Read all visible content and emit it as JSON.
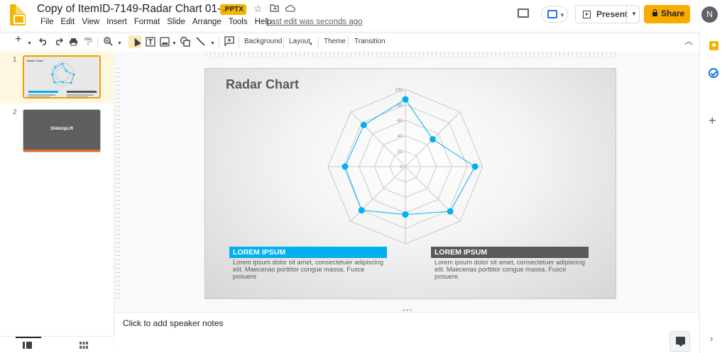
{
  "app": {
    "doc_title": "Copy of ItemID-7149-Radar Chart 01-16x9",
    "file_badge": ".PPTX",
    "last_edit": "Last edit was seconds ago",
    "avatar_initial": "N"
  },
  "menu": [
    "File",
    "Edit",
    "View",
    "Insert",
    "Format",
    "Slide",
    "Arrange",
    "Tools",
    "Help"
  ],
  "header_buttons": {
    "present": "Present",
    "share": "Share"
  },
  "toolbar": {
    "background": "Background",
    "layout": "Layout",
    "theme": "Theme",
    "transition": "Transition"
  },
  "filmstrip": {
    "slides": [
      {
        "number": "1",
        "thumb_title": "Radar Chart"
      },
      {
        "number": "2",
        "thumb_title": "SlideUpLift"
      }
    ]
  },
  "slide": {
    "title": "Radar Chart",
    "box_left": {
      "title": "LOREM IPSUM",
      "text": "Lorem ipsum dolor sit amet, consectetuer adipiscing elit. Maecenas porttitor congue massa. Fusce posuere",
      "color": "#00b0f0"
    },
    "box_right": {
      "title": "LOREM IPSUM",
      "text": "Lorem ipsum dolor sit amet, consectetuer adipiscing elit. Maecenas porttitor congue massa. Fusce posuere",
      "color": "#595959"
    }
  },
  "chart_data": {
    "type": "radar",
    "axes": 8,
    "rlim": [
      0,
      100
    ],
    "tick_labels": [
      "0",
      "20",
      "40",
      "60",
      "80",
      "100"
    ],
    "series": [
      {
        "values": [
          87,
          50,
          90,
          82,
          62,
          80,
          78,
          76
        ],
        "color": "#00b0f0"
      }
    ],
    "grid": true
  },
  "notes": {
    "placeholder": "Click to add speaker notes"
  },
  "colors": {
    "accent": "#f4b400",
    "share": "#f9ab00",
    "chart_series": "#00b0f0"
  }
}
